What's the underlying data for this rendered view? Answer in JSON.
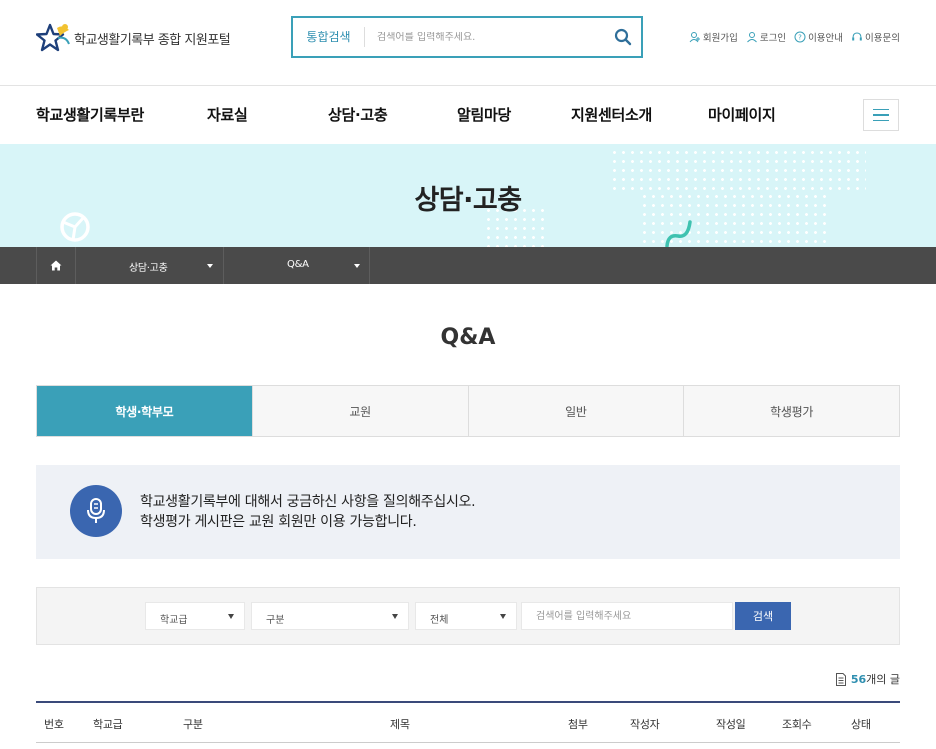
{
  "header": {
    "logo_text": "학교생활기록부 종합 지원포털",
    "search_label": "통합검색",
    "search_placeholder": "검색어를 입력해주세요.",
    "util": [
      {
        "label": "회원가입",
        "icon": "user-add-icon"
      },
      {
        "label": "로그인",
        "icon": "user-icon"
      },
      {
        "label": "이용안내",
        "icon": "help-icon"
      },
      {
        "label": "이용문의",
        "icon": "headset-icon"
      }
    ]
  },
  "gnb": {
    "items": [
      "학교생활기록부란",
      "자료실",
      "상담·고충",
      "알림마당",
      "지원센터소개",
      "마이페이지"
    ]
  },
  "banner": {
    "title": "상담·고충"
  },
  "breadcrumb": {
    "level1": "상담·고충",
    "level2": "Q&A"
  },
  "page": {
    "title": "Q&A"
  },
  "tabs": [
    {
      "label": "학생·학부모",
      "active": true
    },
    {
      "label": "교원",
      "active": false
    },
    {
      "label": "일반",
      "active": false
    },
    {
      "label": "학생평가",
      "active": false
    }
  ],
  "info": {
    "line1": "학교생활기록부에 대해서 궁금하신 사항을 질의해주십시오.",
    "line2": "학생평가 게시판은 교원 회원만 이용 가능합니다."
  },
  "filter": {
    "school_level": "학교급",
    "category": "구분",
    "scope": "전체",
    "keyword_placeholder": "검색어를 입력해주세요",
    "search_button": "검색"
  },
  "count": {
    "number": "56",
    "suffix": "개의 글"
  },
  "table": {
    "columns": [
      "번호",
      "학교급",
      "구분",
      "제목",
      "첨부",
      "작성자",
      "작성일",
      "조회수",
      "상태"
    ]
  },
  "colors": {
    "accent": "#3aa0b8",
    "primary_blue": "#3a66b0",
    "banner_bg": "#d8f5f8",
    "crumb_bg": "#4a4a4a"
  }
}
